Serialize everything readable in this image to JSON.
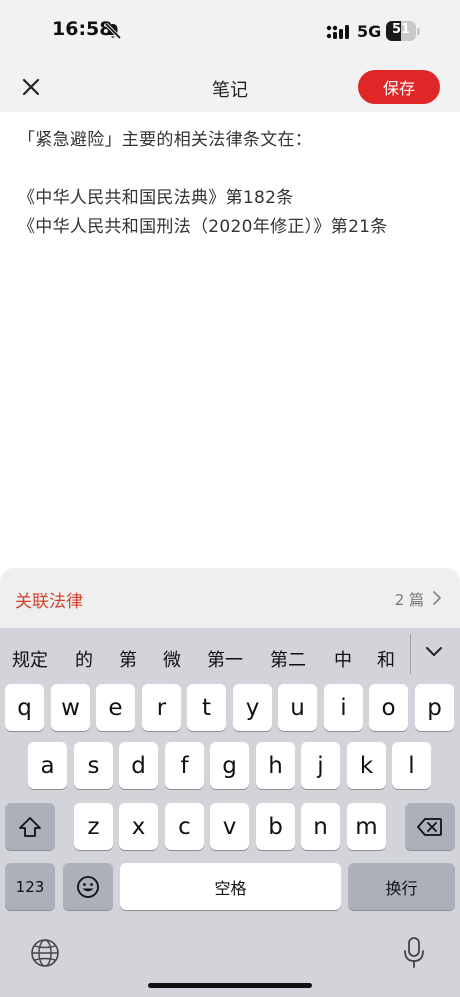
{
  "status_bar": {
    "time": "16:58",
    "network": "5G",
    "battery": "51",
    "battery_level": 0.51
  },
  "header": {
    "title": "笔记",
    "save_label": "保存"
  },
  "note": {
    "lines": [
      "「紧急避险」主要的相关法律条文在：",
      "",
      "《中华人民共和国民法典》第182条",
      "《中华人民共和国刑法（2020年修正）》第21条"
    ]
  },
  "related": {
    "label": "关联法律",
    "count": "2 篇"
  },
  "keyboard": {
    "candidates": [
      "规定",
      "的",
      "第",
      "微",
      "第一",
      "第二",
      "中",
      "和"
    ],
    "row1": [
      "q",
      "w",
      "e",
      "r",
      "t",
      "y",
      "u",
      "i",
      "o",
      "p"
    ],
    "row2": [
      "a",
      "s",
      "d",
      "f",
      "g",
      "h",
      "j",
      "k",
      "l"
    ],
    "row3": [
      "z",
      "x",
      "c",
      "v",
      "b",
      "n",
      "m"
    ],
    "numbers_label": "123",
    "space_label": "空格",
    "return_label": "换行"
  },
  "colors": {
    "accent": "#e02727",
    "related_label": "#d2432d"
  }
}
